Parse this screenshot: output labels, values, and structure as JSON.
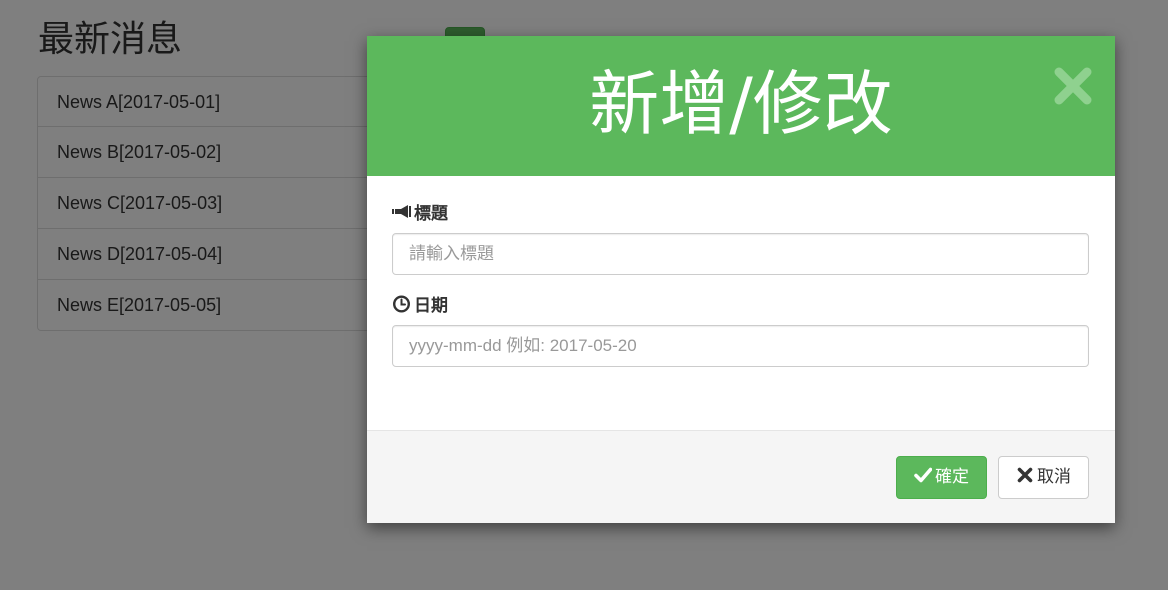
{
  "page": {
    "title": "最新消息"
  },
  "news": {
    "items": [
      {
        "label": "News A[2017-05-01]"
      },
      {
        "label": "News B[2017-05-02]"
      },
      {
        "label": "News C[2017-05-03]"
      },
      {
        "label": "News D[2017-05-04]"
      },
      {
        "label": "News E[2017-05-05]"
      }
    ]
  },
  "modal": {
    "title": "新增/修改",
    "close_icon": "close-icon",
    "title_field": {
      "label": "標題",
      "icon": "bullhorn-icon",
      "value": "",
      "placeholder": "請輸入標題"
    },
    "date_field": {
      "label": "日期",
      "icon": "clock-icon",
      "value": "",
      "placeholder": "yyyy-mm-dd 例如: 2017-05-20"
    },
    "confirm_label": "確定",
    "confirm_icon": "check-icon",
    "cancel_label": "取消",
    "cancel_icon": "times-icon"
  },
  "colors": {
    "header": "#5cb85c",
    "confirm": "#5cb85c",
    "backdrop": "rgba(0,0,0,0.5)"
  }
}
